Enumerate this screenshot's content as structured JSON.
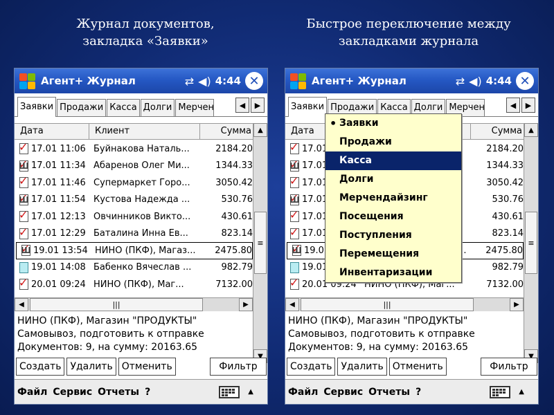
{
  "captions": {
    "left": [
      "Журнал документов,",
      "закладка «Заявки»"
    ],
    "right": [
      "Быстрое переключение между",
      "закладками журнала"
    ]
  },
  "app": {
    "title": "Агент+ Журнал",
    "time": "4:44",
    "icons": [
      "windows-start-icon",
      "connectivity-icon",
      "volume-icon",
      "close-icon"
    ]
  },
  "tabs": [
    "Заявки",
    "Продажи",
    "Касса",
    "Долги",
    "Мерчен"
  ],
  "columns": {
    "date": "Дата",
    "client": "Клиент",
    "sum": "Сумма"
  },
  "rows": [
    {
      "date": "17.01 11:06",
      "client": "Буйнакова Наталь...",
      "sum": "2184.20",
      "icon": "sent"
    },
    {
      "date": "17.01 11:34",
      "client": "Абаренов Олег Ми...",
      "sum": "1344.33",
      "icon": "sent-marked"
    },
    {
      "date": "17.01 11:46",
      "client": "Супермаркет Горо...",
      "sum": "3050.42",
      "icon": "sent"
    },
    {
      "date": "17.01 11:54",
      "client": "Кустова Надежда ...",
      "sum": "530.76",
      "icon": "sent-marked"
    },
    {
      "date": "17.01 12:13",
      "client": "Овчинников Викто...",
      "sum": "430.61",
      "icon": "sent"
    },
    {
      "date": "17.01 12:29",
      "client": "Баталина Инна  Ев...",
      "sum": "823.14",
      "icon": "sent"
    },
    {
      "date": "19.01 13:54",
      "client": "НИНО (ПКФ), Магаз...",
      "sum": "2475.80",
      "icon": "sent-marked"
    },
    {
      "date": "19.01 14:08",
      "client": "Бабенко Вячеслав ...",
      "sum": "982.79",
      "icon": "draft"
    },
    {
      "date": "20.01 09:24",
      "client": "НИНО (ПКФ), Маг...",
      "sum": "7132.00",
      "icon": "sent"
    }
  ],
  "selected_row": 6,
  "info": {
    "line1": "НИНО (ПКФ), Магазин \"ПРОДУКТЫ\"",
    "line2": "Самовывоз, подготовить к отправке",
    "line3": "Документов: 9, на сумму: 20163.65"
  },
  "buttons": {
    "create": "Создать",
    "delete": "Удалить",
    "cancel": "Отменить",
    "filter": "Фильтр"
  },
  "menu": {
    "file": "Файл",
    "service": "Сервис",
    "reports": "Отчеты",
    "help": "?"
  },
  "dropdown": {
    "items": [
      "Заявки",
      "Продажи",
      "Касса",
      "Долги",
      "Мерчендайзинг",
      "Посещения",
      "Поступления",
      "Перемещения",
      "Инвентаризации"
    ],
    "current": 0,
    "highlighted": 2
  }
}
